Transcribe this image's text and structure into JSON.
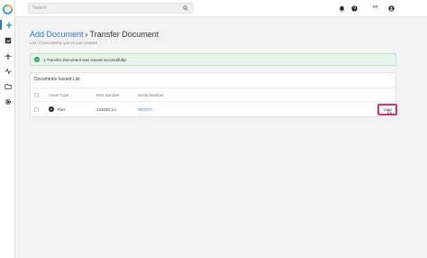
{
  "search": {
    "placeholder": "Search"
  },
  "header": {
    "language": "en"
  },
  "page": {
    "breadcrumb": "Add Document",
    "separator": "›",
    "title": "Transfer Document",
    "subtitle": "List of Documents you've just created"
  },
  "alert": {
    "message": "1 Transfer Document was issued successfully!"
  },
  "documents": {
    "title": "Documents Issued List",
    "columns": [
      "Asset Type",
      "Part Number",
      "Serial Number"
    ],
    "rows": [
      {
        "asset_type": "Part",
        "part_number": "223045-1A",
        "serial_number": "SP2377",
        "action": "View"
      }
    ]
  },
  "colors": {
    "accent": "#2d7bd6",
    "success": "#2e9e5b",
    "highlight": "#e3305f"
  }
}
